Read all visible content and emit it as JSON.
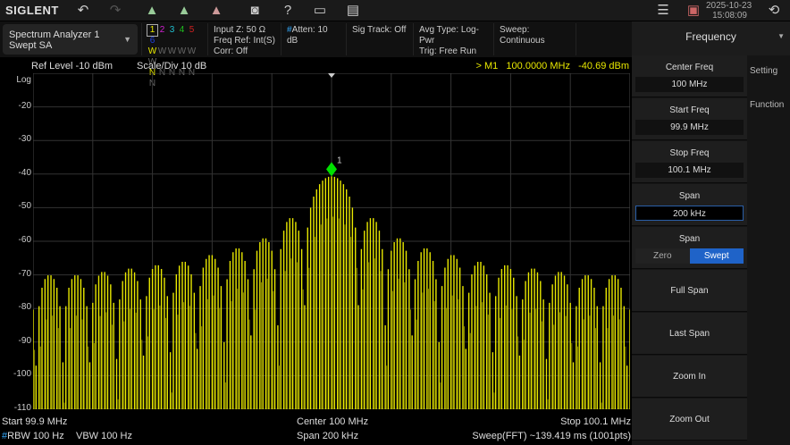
{
  "topbar": {
    "brand": "SIGLENT",
    "date": "2025-10-23",
    "time": "15:08:09",
    "icons": [
      "undo-icon",
      "redo-icon",
      "peak-search-icon",
      "add-marker-icon",
      "delete-marker-icon",
      "camera-icon",
      "help-icon",
      "folder-icon",
      "message-icon",
      "menu-list-icon",
      "network-icon",
      "power-icon"
    ]
  },
  "mode": {
    "line1": "Spectrum Analyzer 1",
    "line2": "Swept SA"
  },
  "traces": {
    "numbers": [
      "1",
      "2",
      "3",
      "4",
      "5",
      "6"
    ],
    "colors": [
      "#e8e800",
      "#d020d0",
      "#20c0d0",
      "#20c020",
      "#d02020",
      "#2040e0"
    ],
    "types": [
      "W",
      "W",
      "W",
      "W",
      "W",
      "W"
    ],
    "detectors": [
      "N",
      "N",
      "N",
      "N",
      "N",
      "N"
    ]
  },
  "info": {
    "input_z": "Input Z: 50 Ω",
    "freq_ref": "Freq Ref: Int(S)",
    "corr": "Corr: Off",
    "atten_hash": "#",
    "atten": "Atten: 10 dB",
    "sig_track": "Sig Track: Off",
    "avg_type": "Avg Type: Log-Pwr",
    "trig": "Trig: Free Run",
    "sweep": "Sweep: Continuous"
  },
  "plot_header": {
    "ref_level": "Ref Level  -10 dBm",
    "scale": "Scale/Div  10 dB",
    "marker": "> M1   100.0000 MHz   -40.69 dBm"
  },
  "chart_data": {
    "type": "line",
    "y_axis_label": "Log",
    "y_ticks": [
      "-20",
      "-30",
      "-40",
      "-50",
      "-60",
      "-70",
      "-80",
      "-90",
      "-100",
      "-110"
    ],
    "ylim": [
      -110,
      -10
    ],
    "xlim_mhz": [
      99.9,
      100.1
    ],
    "grid": true,
    "trace_color": "#e8e800",
    "marker": {
      "label": "1",
      "freq_mhz": 100.0,
      "level_dbm": -40.69,
      "color": "#00e000"
    },
    "lobe_peaks_dbm": [
      -40.69,
      -53,
      -59,
      -62,
      -64,
      -66,
      -67,
      -68,
      -69,
      -70,
      -70,
      -71
    ]
  },
  "footer": {
    "start": "Start  99.9 MHz",
    "center": "Center  100 MHz",
    "stop": "Stop  100.1 MHz",
    "rbw_hash": "#",
    "rbw": "RBW  100 Hz",
    "vbw": "VBW  100 Hz",
    "span": "Span  200 kHz",
    "sweep": "Sweep(FFT)  ~139.419 ms (1001pts)"
  },
  "menu": {
    "title": "Frequency",
    "tabs": [
      "Setting",
      "Function"
    ],
    "center_label": "Center Freq",
    "center_value": "100 MHz",
    "start_label": "Start Freq",
    "start_value": "99.9 MHz",
    "stop_label": "Stop Freq",
    "stop_value": "100.1 MHz",
    "span_label": "Span",
    "span_value": "200 kHz",
    "span_mode_label": "Span",
    "zero": "Zero",
    "swept": "Swept",
    "full_span": "Full Span",
    "last_span": "Last Span",
    "zoom_in": "Zoom In",
    "zoom_out": "Zoom Out"
  }
}
